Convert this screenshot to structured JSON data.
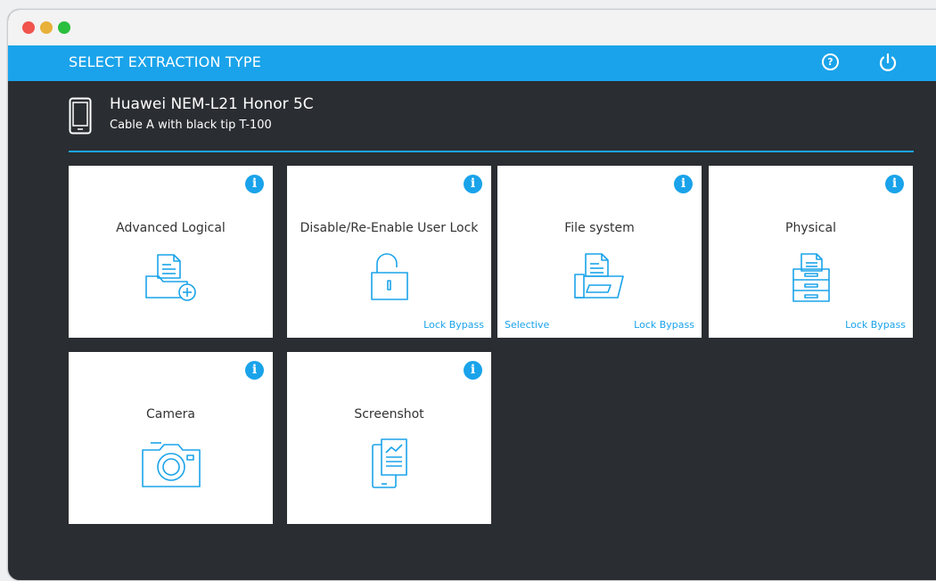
{
  "header": {
    "title": "SELECT EXTRACTION TYPE",
    "help_glyph": "?",
    "help_icon": "help-circle-icon",
    "power_icon": "power-icon"
  },
  "device": {
    "name": "Huawei NEM-L21 Honor 5C",
    "cable": "Cable A with black tip T-100",
    "icon": "phone-icon"
  },
  "colors": {
    "accent": "#1aa3ea",
    "background": "#2a2d31",
    "tile": "#ffffff"
  },
  "tiles": [
    {
      "title": "Advanced Logical",
      "icon": "folder-add-icon",
      "info": "i",
      "left_tag": "",
      "right_tag": ""
    },
    {
      "title": "Disable/Re-Enable User Lock",
      "icon": "unlock-icon",
      "info": "i",
      "left_tag": "",
      "right_tag": "Lock Bypass"
    },
    {
      "title": "File system",
      "icon": "open-folder-icon",
      "info": "i",
      "left_tag": "Selective",
      "right_tag": "Lock Bypass"
    },
    {
      "title": "Physical",
      "icon": "cabinet-icon",
      "info": "i",
      "left_tag": "",
      "right_tag": "Lock Bypass"
    },
    {
      "title": "Camera",
      "icon": "camera-icon",
      "info": "i",
      "left_tag": "",
      "right_tag": ""
    },
    {
      "title": "Screenshot",
      "icon": "screenshot-icon",
      "info": "i",
      "left_tag": "",
      "right_tag": ""
    }
  ]
}
